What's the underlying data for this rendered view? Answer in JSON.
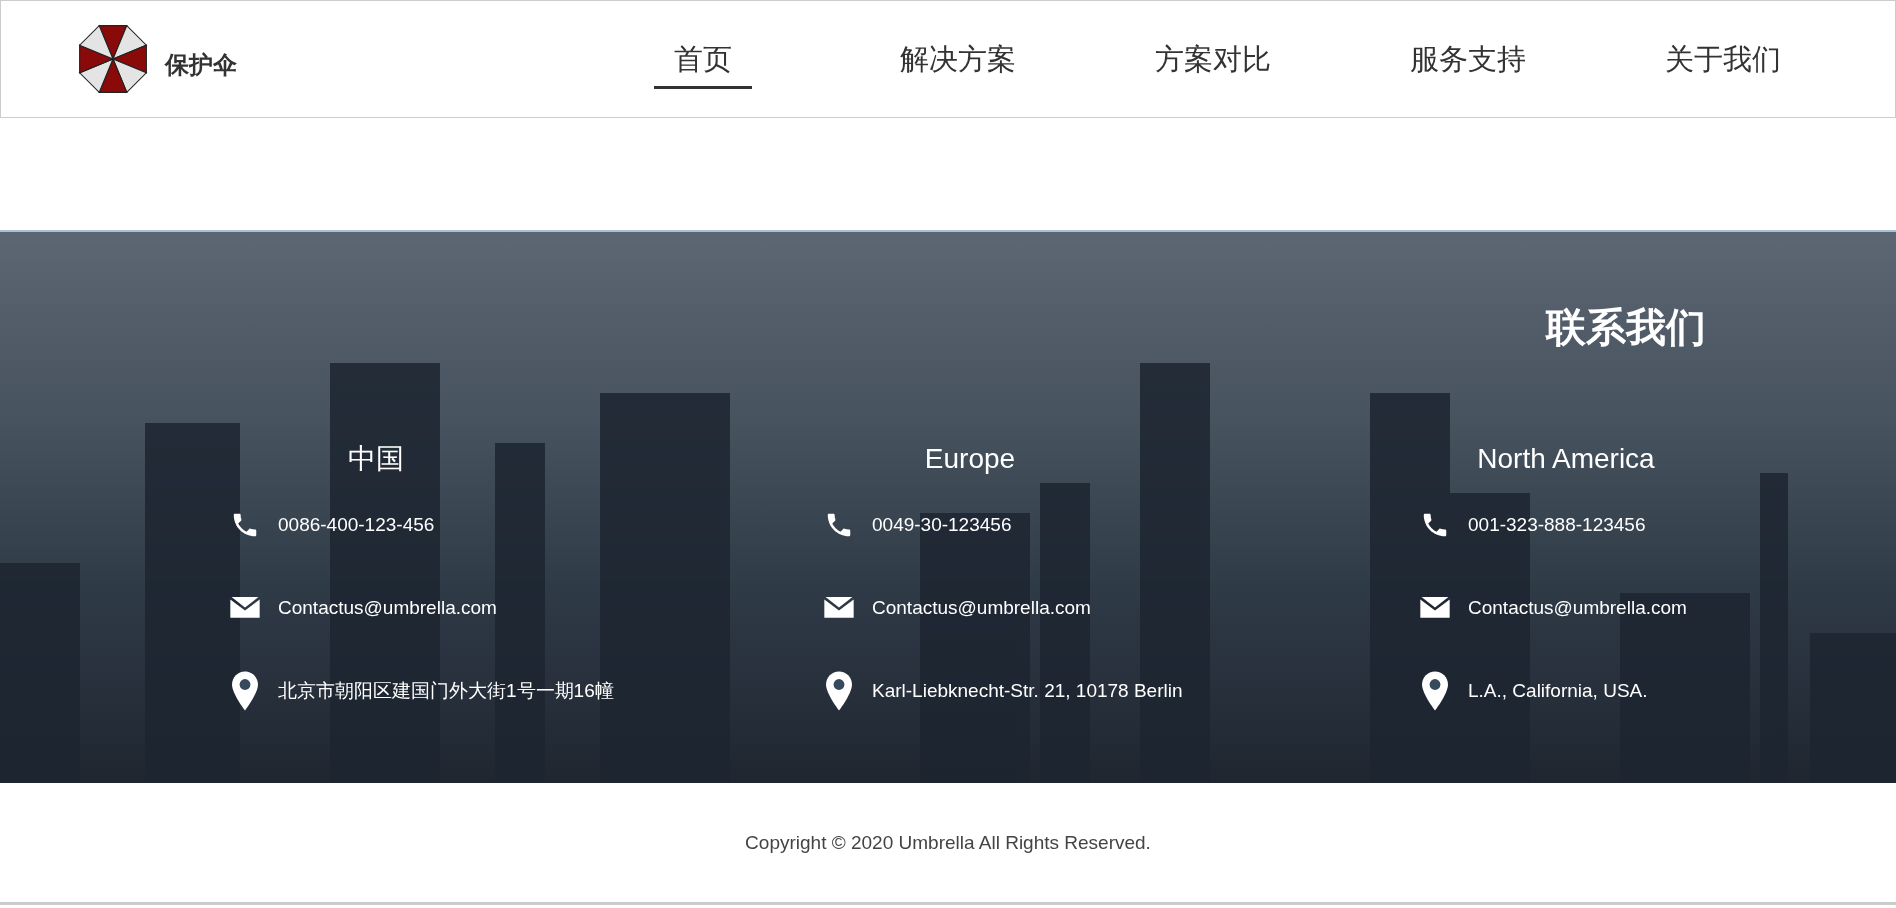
{
  "header": {
    "brand": "保护伞",
    "nav": [
      {
        "label": "首页",
        "selected": true
      },
      {
        "label": "解决方案",
        "selected": false
      },
      {
        "label": "方案对比",
        "selected": false
      },
      {
        "label": "服务支持",
        "selected": false
      },
      {
        "label": "关于我们",
        "selected": false
      }
    ]
  },
  "contact": {
    "title": "联系我们",
    "regions": [
      {
        "name": "中国",
        "items": [
          {
            "kind": "phone",
            "text": "0086-400-123-456"
          },
          {
            "kind": "email",
            "text": "Contactus@umbrella.com"
          },
          {
            "kind": "address",
            "text": "北京市朝阳区建国门外大街1号一期16幢"
          }
        ]
      },
      {
        "name": "Europe",
        "items": [
          {
            "kind": "phone",
            "text": "0049-30-123456"
          },
          {
            "kind": "email",
            "text": "Contactus@umbrella.com"
          },
          {
            "kind": "address",
            "text": "Karl-Liebknecht-Str. 21, 10178 Berlin"
          }
        ]
      },
      {
        "name": "North America",
        "items": [
          {
            "kind": "phone",
            "text": "001-323-888-123456"
          },
          {
            "kind": "email",
            "text": "Contactus@umbrella.com"
          },
          {
            "kind": "address",
            "text": "L.A., California, USA."
          }
        ]
      }
    ]
  },
  "footer": {
    "copyright": "Copyright © 2020 Umbrella All Rights Reserved."
  }
}
